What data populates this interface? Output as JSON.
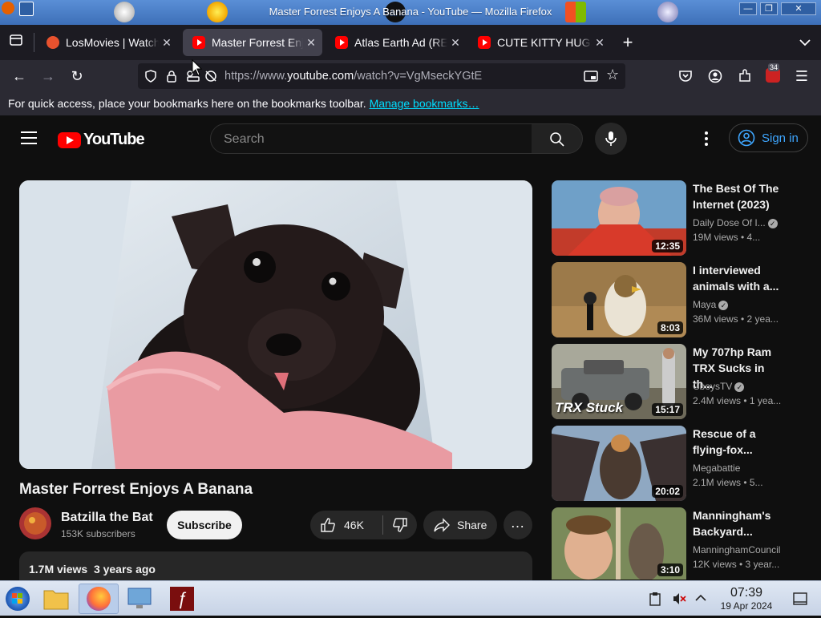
{
  "window": {
    "title": "Master Forrest Enjoys A Banana - YouTube — Mozilla Firefox",
    "controls": {
      "minimize": "—",
      "maximize": "❐",
      "close": "✕"
    }
  },
  "tabs": [
    {
      "label": "LosMovies | Watch",
      "active": false
    },
    {
      "label": "Master Forrest Enjoys A Banana",
      "active": true
    },
    {
      "label": "Atlas Earth Ad (REAL)",
      "active": false
    },
    {
      "label": "CUTE KITTY HUGS",
      "active": false
    }
  ],
  "navbar": {
    "url_prefix": "https://www.",
    "url_domain": "youtube.com",
    "url_path": "/watch?v=VgMseckYGtE",
    "extension_badge": "34"
  },
  "bookmarks": {
    "message": "For quick access, place your bookmarks here on the bookmarks toolbar.",
    "link": "Manage bookmarks…"
  },
  "youtube": {
    "logo": "YouTube",
    "search_placeholder": "Search",
    "sign_in": "Sign in"
  },
  "video": {
    "title": "Master Forrest Enjoys A Banana",
    "channel": "Batzilla the Bat",
    "subscribers": "153K subscribers",
    "subscribe": "Subscribe",
    "likes": "46K",
    "share": "Share",
    "views": "1.7M views",
    "age": "3 years ago"
  },
  "recommended": [
    {
      "title": "The Best Of The Internet (2023)",
      "channel": "Daily Dose Of I...",
      "verified": true,
      "meta": "19M views • 4...",
      "duration": "12:35",
      "thumb_color": "#6fa0c8"
    },
    {
      "title": "I interviewed animals with a...",
      "channel": "Maya",
      "verified": true,
      "meta": "36M views • 2 yea...",
      "duration": "8:03",
      "thumb_color": "#9c7a4a"
    },
    {
      "title": "My 707hp Ram TRX Sucks in th...",
      "channel": "CboysTV",
      "verified": true,
      "meta": "2.4M views • 1 yea...",
      "duration": "15:17",
      "thumb_color": "#8a8f80",
      "overlay": "TRX Stuck"
    },
    {
      "title": "Rescue of a flying-fox...",
      "channel": "Megabattie",
      "verified": false,
      "meta": "2.1M views • 5...",
      "duration": "20:02",
      "thumb_color": "#8fa8c2"
    },
    {
      "title": "Manningham's Backyard...",
      "channel": "ManninghamCouncil",
      "verified": false,
      "meta": "12K views • 3 year...",
      "duration": "3:10",
      "thumb_color": "#7a8a5a"
    }
  ],
  "taskbar": {
    "time": "07:39",
    "date": "19 Apr 2024"
  },
  "colors": {
    "yt_red": "#ff0000",
    "yt_bg": "#0f0f0f",
    "firefox_tabbar": "#1c1b22",
    "link_blue": "#3ea6ff"
  }
}
